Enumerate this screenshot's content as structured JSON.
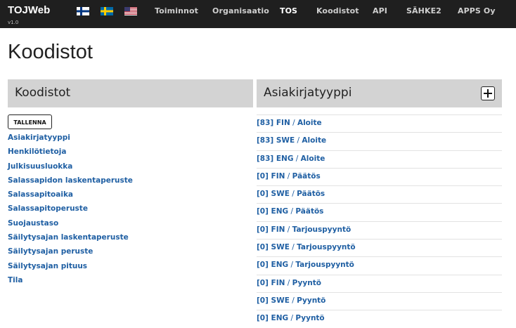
{
  "brand": {
    "name": "TOJWeb",
    "version": "v1.0"
  },
  "flags": [
    {
      "name": "finnish-flag-icon",
      "colors": [
        "#ffffff",
        "#003580"
      ]
    },
    {
      "name": "swedish-flag-icon",
      "colors": [
        "#006aa7",
        "#fecc00"
      ]
    },
    {
      "name": "us-flag-icon",
      "colors": [
        "#b22234",
        "#ffffff",
        "#3c3b6e"
      ]
    }
  ],
  "nav": {
    "items": [
      {
        "label": "Toiminnot",
        "active": false
      },
      {
        "label": "Organisaatio",
        "active": false
      },
      {
        "label": "TOS",
        "active": true
      },
      {
        "label": "Koodistot",
        "active": false
      },
      {
        "label": "API",
        "active": false
      },
      {
        "label": "SÄHKE2",
        "active": false
      },
      {
        "label": "APPS Oy",
        "active": false
      }
    ]
  },
  "page": {
    "title": "Koodistot"
  },
  "left_panel": {
    "title": "Koodistot",
    "save_label": "Tallenna",
    "items": [
      "Asiakirjatyyppi",
      "Henkilötietoja",
      "Julkisuusluokka",
      "Salassapidon laskentaperuste",
      "Salassapitoaika",
      "Salassapitoperuste",
      "Suojaustaso",
      "Säilytysajan laskentaperuste",
      "Säilytysajan peruste",
      "Säilytysajan pituus",
      "Tila"
    ]
  },
  "right_panel": {
    "title": "Asiakirjatyyppi",
    "add_icon": "plus-icon",
    "items": [
      {
        "code": "[83] FIN",
        "name": "Aloite"
      },
      {
        "code": "[83] SWE",
        "name": "Aloite"
      },
      {
        "code": "[83] ENG",
        "name": "Aloite"
      },
      {
        "code": "[0] FIN",
        "name": "Päätös"
      },
      {
        "code": "[0] SWE",
        "name": "Päätös"
      },
      {
        "code": "[0] ENG",
        "name": "Päätös"
      },
      {
        "code": "[0] FIN",
        "name": "Tarjouspyyntö"
      },
      {
        "code": "[0] SWE",
        "name": "Tarjouspyyntö"
      },
      {
        "code": "[0] ENG",
        "name": "Tarjouspyyntö"
      },
      {
        "code": "[0] FIN",
        "name": "Pyyntö"
      },
      {
        "code": "[0] SWE",
        "name": "Pyyntö"
      },
      {
        "code": "[0] ENG",
        "name": "Pyyntö"
      }
    ]
  },
  "colors": {
    "navbar": "#1f1f1f",
    "link": "#1f5fa3",
    "panel_header": "#d3d3d3"
  }
}
